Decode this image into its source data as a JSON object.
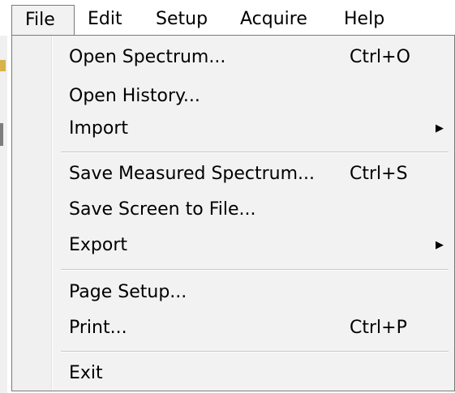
{
  "menubar": {
    "items": [
      {
        "label": "File"
      },
      {
        "label": "Edit"
      },
      {
        "label": "Setup"
      },
      {
        "label": "Acquire"
      },
      {
        "label": "Help"
      }
    ],
    "active": "File"
  },
  "file_menu": {
    "items": [
      {
        "label": "Open Spectrum...",
        "shortcut": "Ctrl+O"
      },
      {
        "label": "Open History...",
        "shortcut": ""
      },
      {
        "label": "Import",
        "submenu_icon": "submenu-arrow-icon"
      },
      {
        "label": "Save Measured Spectrum...",
        "shortcut": "Ctrl+S"
      },
      {
        "label": "Save Screen to File...",
        "shortcut": ""
      },
      {
        "label": "Export",
        "submenu_icon": "submenu-arrow-icon"
      },
      {
        "label": "Page Setup...",
        "shortcut": ""
      },
      {
        "label": "Print...",
        "shortcut": "Ctrl+P"
      },
      {
        "label": "Exit",
        "shortcut": ""
      }
    ],
    "arrow_glyph": "▶"
  }
}
